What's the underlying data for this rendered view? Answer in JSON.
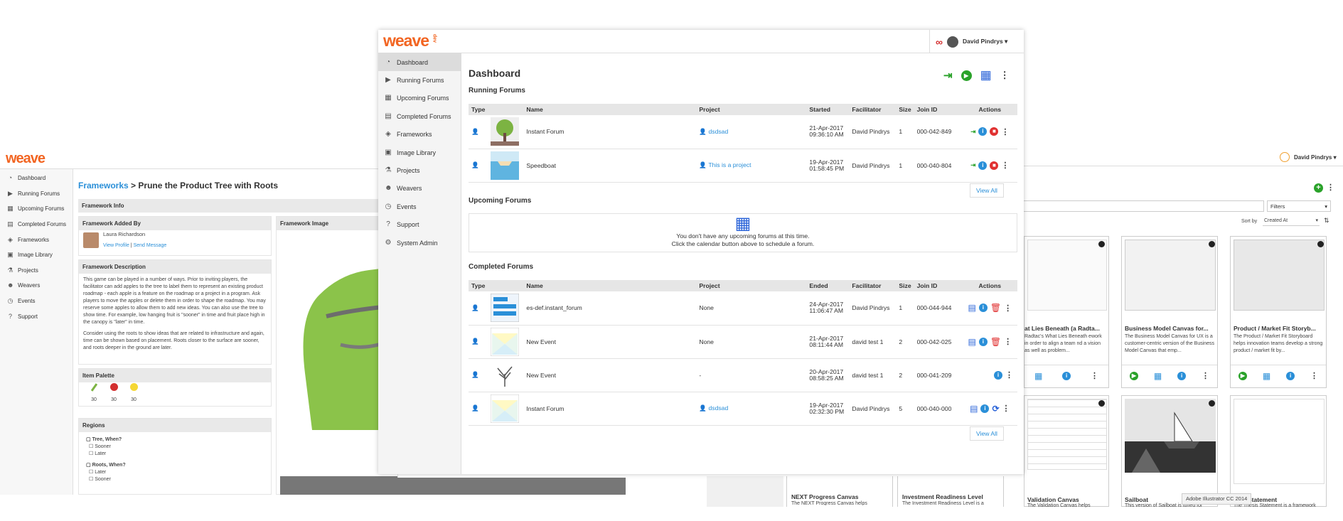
{
  "left": {
    "logo": "weave",
    "sidebar": [
      "Dashboard",
      "Running Forums",
      "Upcoming Forums",
      "Completed Forums",
      "Frameworks",
      "Image Library",
      "Projects",
      "Weavers",
      "Events",
      "Support"
    ],
    "breadcrumb_link": "Frameworks",
    "breadcrumb_rest": "> Prune the Product Tree with Roots",
    "framework_info": "Framework Info",
    "added_by_title": "Framework Added By",
    "added_by_name": "Laura Richardson",
    "view_profile": "View Profile",
    "separator": "|",
    "send_message": "Send Message",
    "desc_title": "Framework Description",
    "desc_p1": "This game can be played in a number of ways. Prior to inviting players, the facilitator can add apples to the tree to label them to represent an existing product roadmap - each apple is a feature on the roadmap or a project in a program. Ask players to move the apples or delete them in order to shape the roadmap. You may reserve some apples to allow them to add new ideas. You can also use the tree to show time. For example, low hanging fruit is \"sooner\" in time and fruit place high in the canopy is \"later\" in time.",
    "desc_p2": "Consider using the roots to show ideas that are related to infrastructure and again, time can be shown based on placement. Roots closer to the surface are sooner, and roots deeper in the ground are later.",
    "palette_title": "Item Palette",
    "palette_counts": [
      "30",
      "30",
      "30"
    ],
    "regions_title": "Regions",
    "region1": "Tree, When?",
    "region1_opts": [
      "Sooner",
      "Later"
    ],
    "region2": "Roots, When?",
    "region2_opts": [
      "Later",
      "Sooner"
    ],
    "image_title": "Framework Image"
  },
  "right": {
    "user": "David Pindrys ▾",
    "filters": "Filters",
    "sort_by": "Sort by",
    "sort_value": "Created At",
    "cards_row1": [
      {
        "title": "at Lies Beneath (a Radta...",
        "desc": "Radtac's What Lies Beneath ework in order to align a team nd a vision as well as problem..."
      },
      {
        "title": "Business Model Canvas for...",
        "desc": "The Business Model Canvas for UX is a customer-centric version of the Business Model Canvas that emp..."
      },
      {
        "title": "Product / Market Fit Storyb...",
        "desc": "The Product / Market Fit Storyboard helps innovation teams develop a strong product / market fit by..."
      }
    ],
    "cards_row2": [
      {
        "title": "Validation Canvas",
        "desc": "The Validation Canvas helps"
      },
      {
        "title": "Sailboat",
        "desc": "This version of Sailboat is tuned for"
      },
      {
        "title": "Statement",
        "desc": "The Thesis Statement is a framework"
      }
    ],
    "bottom_titles": [
      "NEXT Progress Canvas",
      "Investment Readiness Level"
    ],
    "bottom_descs": [
      "The NEXT Progress Canvas helps",
      "The Investment Readiness Level is a"
    ],
    "tooltip": "Adobe Illustrator CC 2014"
  },
  "main": {
    "logo": "weave",
    "logo_sub": "dev",
    "user": "David Pindrys ▾",
    "sidebar": [
      "Dashboard",
      "Running Forums",
      "Upcoming Forums",
      "Completed Forums",
      "Frameworks",
      "Image Library",
      "Projects",
      "Weavers",
      "Events",
      "Support",
      "System Admin"
    ],
    "title": "Dashboard",
    "running_title": "Running Forums",
    "running_cols": [
      "Type",
      "Name",
      "Project",
      "Started",
      "Facilitator",
      "Size",
      "Join ID",
      "Actions"
    ],
    "running_rows": [
      {
        "name": "Instant Forum",
        "project": "dsdsad",
        "date": "21-Apr-2017",
        "time": "09:36:10 AM",
        "facilitator": "David Pindrys",
        "size": "1",
        "join": "000-042-849"
      },
      {
        "name": "Speedboat",
        "project": "This is a project",
        "date": "19-Apr-2017",
        "time": "01:58:45 PM",
        "facilitator": "David Pindrys",
        "size": "1",
        "join": "000-040-804"
      }
    ],
    "view_all": "View All",
    "upcoming_title": "Upcoming Forums",
    "upcoming_empty_1": "You don't have any upcoming forums at this time.",
    "upcoming_empty_2": "Click the calendar button above to schedule a forum.",
    "completed_title": "Completed Forums",
    "completed_cols": [
      "Type",
      "Name",
      "Project",
      "Ended",
      "Facilitator",
      "Size",
      "Join ID",
      "Actions"
    ],
    "completed_rows": [
      {
        "name": "es-def.instant_forum",
        "project": "None",
        "date": "24-Apr-2017",
        "time": "11:06:47 AM",
        "facilitator": "David Pindrys",
        "size": "1",
        "join": "000-044-944"
      },
      {
        "name": "New Event",
        "project": "None",
        "date": "21-Apr-2017",
        "time": "08:11:44 AM",
        "facilitator": "david test 1",
        "size": "2",
        "join": "000-042-025"
      },
      {
        "name": "New Event",
        "project": "-",
        "date": "20-Apr-2017",
        "time": "08:58:25 AM",
        "facilitator": "david test 1",
        "size": "2",
        "join": "000-041-209"
      },
      {
        "name": "Instant Forum",
        "project": "dsdsad",
        "date": "19-Apr-2017",
        "time": "02:32:30 PM",
        "facilitator": "David Pindrys",
        "size": "5",
        "join": "000-040-000"
      }
    ],
    "colors": {
      "green": "#2aa22a",
      "blue": "#2a8fd8",
      "red": "#e03030",
      "orange": "#f26522"
    }
  }
}
